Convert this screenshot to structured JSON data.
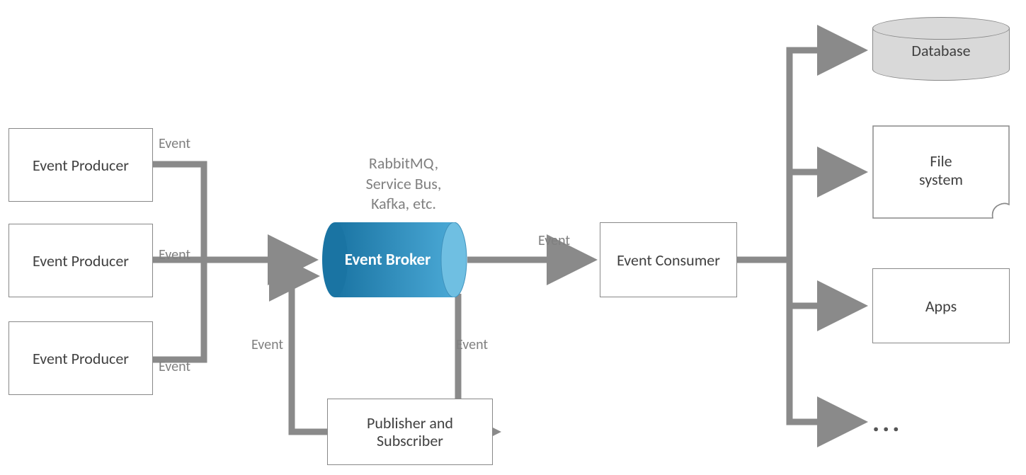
{
  "nodes": {
    "producer1": "Event Producer",
    "producer2": "Event Producer",
    "producer3": "Event Producer",
    "broker": "Event Broker",
    "pubsub": "Publisher and Subscriber",
    "consumer": "Event Consumer",
    "database": "Database",
    "filesystem": "File\nsystem",
    "apps": "Apps",
    "more": "..."
  },
  "brokerNote": "RabbitMQ,\nService Bus,\nKafka, etc.",
  "edgeLabels": {
    "p1": "Event",
    "p2": "Event",
    "p3": "Event",
    "brokerToConsumer": "Event",
    "pubToBroker": "Event",
    "brokerToPub": "Event"
  }
}
